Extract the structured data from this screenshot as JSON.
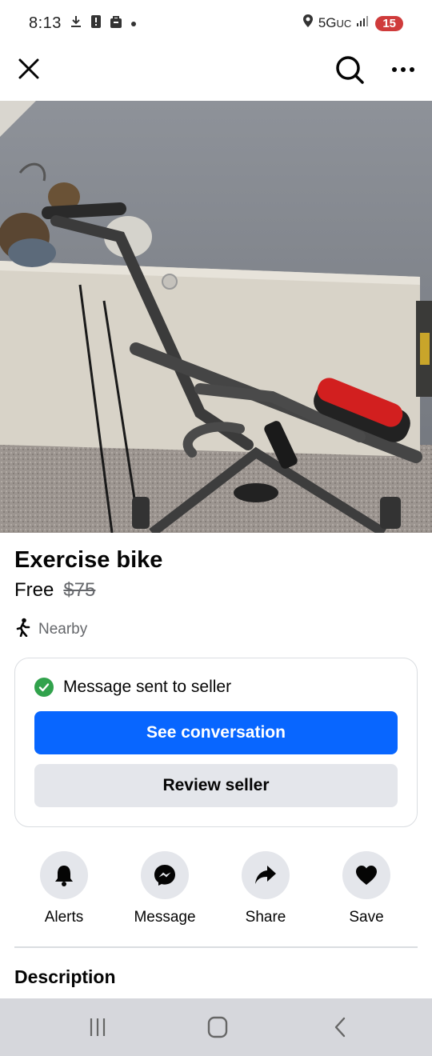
{
  "status_bar": {
    "time": "8:13",
    "network": "5G",
    "network_suffix": "UC",
    "battery": "15",
    "icons": [
      "download-icon",
      "alert-icon",
      "bag-icon",
      "dot-icon",
      "location-icon",
      "signal-icon"
    ]
  },
  "app_bar": {
    "icons": [
      "close-icon",
      "search-icon",
      "more-icon"
    ]
  },
  "listing": {
    "title": "Exercise bike",
    "price": "Free",
    "original_price": "$75",
    "location": "Nearby"
  },
  "message_card": {
    "status_text": "Message sent to seller",
    "primary_button": "See conversation",
    "secondary_button": "Review seller",
    "colors": {
      "primary": "#0866ff",
      "success": "#31a24c"
    }
  },
  "actions": [
    {
      "label": "Alerts",
      "icon": "bell-icon"
    },
    {
      "label": "Message",
      "icon": "messenger-icon"
    },
    {
      "label": "Share",
      "icon": "share-icon"
    },
    {
      "label": "Save",
      "icon": "heart-icon"
    }
  ],
  "description": {
    "heading": "Description"
  },
  "nav": {
    "icons": [
      "recent-apps-icon",
      "home-icon",
      "back-icon"
    ]
  }
}
